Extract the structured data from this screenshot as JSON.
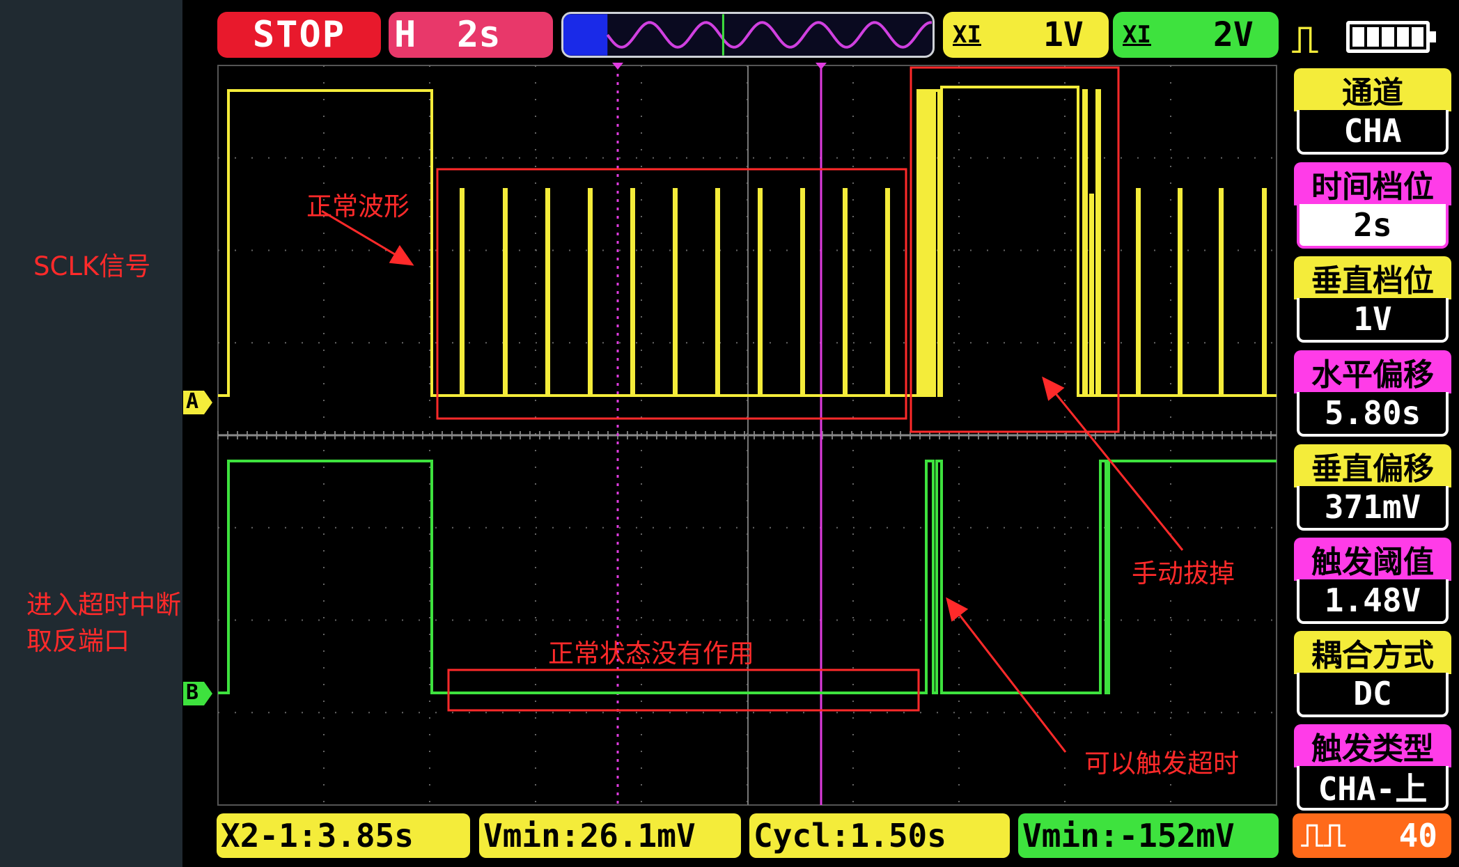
{
  "annotations": {
    "sclk": "SCLK信号",
    "timeout_line1": "进入超时中断",
    "timeout_line2": "取反端口",
    "normal_waveform": "正常波形",
    "no_effect": "正常状态没有作用",
    "manual_unplug": "手动拔掉",
    "trigger_timeout": "可以触发超时"
  },
  "top_bar": {
    "run_state": "STOP",
    "timebase_label": "H",
    "timebase_value": "2s",
    "ch1_prefix": "XI",
    "ch1_volts": "1V",
    "ch2_prefix": "XI",
    "ch2_volts": "2V",
    "trigger_edge_icon": "rising-edge-icon",
    "battery_icon": "battery-full-icon"
  },
  "side_menu": [
    {
      "label": "通道",
      "value": "CHA",
      "color": "#f4ec3a"
    },
    {
      "label": "时间档位",
      "value": "2s",
      "color": "#ff3ce8"
    },
    {
      "label": "垂直档位",
      "value": "1V",
      "color": "#f4ec3a"
    },
    {
      "label": "水平偏移",
      "value": "5.80s",
      "color": "#ff3ce8"
    },
    {
      "label": "垂直偏移",
      "value": "371mV",
      "color": "#f4ec3a"
    },
    {
      "label": "触发阈值",
      "value": "1.48V",
      "color": "#ff3ce8"
    },
    {
      "label": "耦合方式",
      "value": "DC",
      "color": "#f4ec3a"
    },
    {
      "label": "触发类型",
      "value": "CHA-上",
      "color": "#ff3ce8"
    }
  ],
  "bottom_bar": {
    "m1": "X2-1:3.85s",
    "m2": "Vmin:26.1mV",
    "m3": "Cycl:1.50s",
    "m4": "Vmin:-152mV",
    "pulse_icon": "pulse-icon",
    "count": "40"
  },
  "channel_markers": {
    "a": "A",
    "b": "B"
  },
  "colors": {
    "ch_a": "#f4ec3a",
    "ch_b": "#3ee23e",
    "cursor": "#e03ce0",
    "annotation": "#ff2a2a"
  }
}
